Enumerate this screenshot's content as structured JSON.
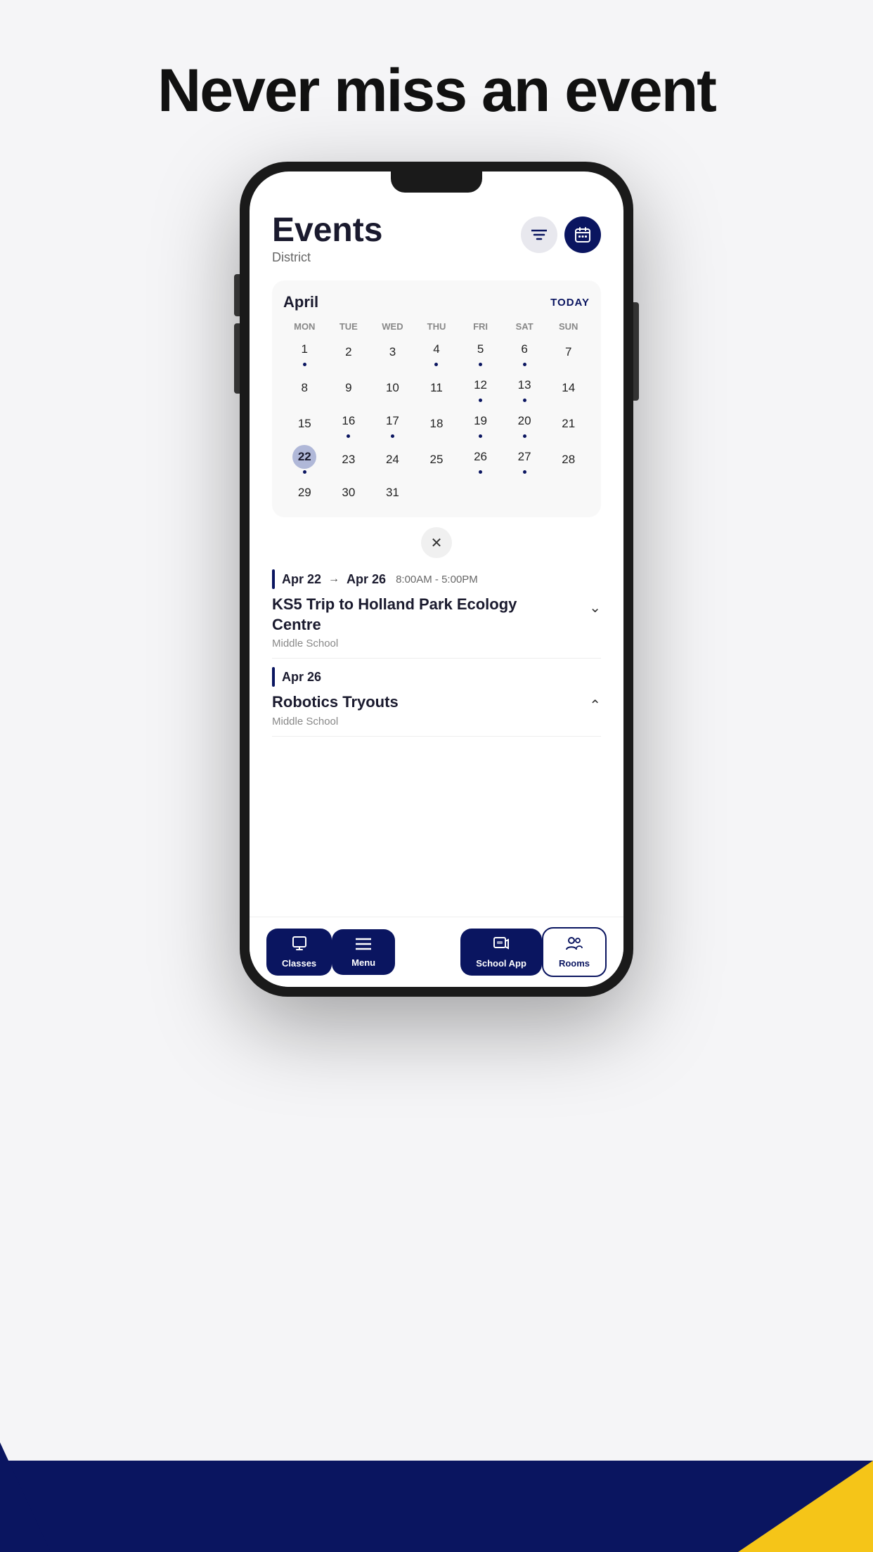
{
  "hero": {
    "title": "Never miss an event"
  },
  "app": {
    "screen_title": "Events",
    "screen_subtitle": "District"
  },
  "calendar": {
    "month": "April",
    "today_label": "TODAY",
    "days_of_week": [
      "MON",
      "TUE",
      "WED",
      "THU",
      "FRI",
      "SAT",
      "SUN"
    ],
    "weeks": [
      [
        {
          "num": "1",
          "dot": true
        },
        {
          "num": "2",
          "dot": false
        },
        {
          "num": "3",
          "dot": false
        },
        {
          "num": "4",
          "dot": true
        },
        {
          "num": "5",
          "dot": true
        },
        {
          "num": "6",
          "dot": true
        },
        {
          "num": "7",
          "dot": false
        }
      ],
      [
        {
          "num": "8",
          "dot": false
        },
        {
          "num": "9",
          "dot": false
        },
        {
          "num": "10",
          "dot": false
        },
        {
          "num": "11",
          "dot": false
        },
        {
          "num": "12",
          "dot": true
        },
        {
          "num": "13",
          "dot": true
        },
        {
          "num": "14",
          "dot": false
        }
      ],
      [
        {
          "num": "15",
          "dot": false
        },
        {
          "num": "16",
          "dot": true
        },
        {
          "num": "17",
          "dot": true
        },
        {
          "num": "18",
          "dot": false
        },
        {
          "num": "19",
          "dot": true
        },
        {
          "num": "20",
          "dot": true
        },
        {
          "num": "21",
          "dot": false
        }
      ],
      [
        {
          "num": "22",
          "dot": true,
          "selected": true
        },
        {
          "num": "23",
          "dot": false
        },
        {
          "num": "24",
          "dot": false
        },
        {
          "num": "25",
          "dot": false
        },
        {
          "num": "26",
          "dot": true
        },
        {
          "num": "27",
          "dot": true
        },
        {
          "num": "28",
          "dot": false
        }
      ],
      [
        {
          "num": "29",
          "dot": false
        },
        {
          "num": "30",
          "dot": false
        },
        {
          "num": "31",
          "dot": false
        },
        null,
        null,
        null,
        null
      ]
    ]
  },
  "events": [
    {
      "date_start": "Apr 22",
      "date_end": "Apr 26",
      "time": "8:00AM - 5:00PM",
      "title": "KS5 Trip to Holland Park Ecology Centre",
      "school": "Middle School",
      "expanded": false
    },
    {
      "date_start": "Apr 26",
      "date_end": null,
      "time": null,
      "title": "Robotics Tryouts",
      "school": "Middle School",
      "expanded": true
    }
  ],
  "nav": {
    "items": [
      {
        "label": "Classes",
        "icon": "🎓",
        "active": false
      },
      {
        "label": "Menu",
        "icon": "☰",
        "active": false
      },
      {
        "label": "School App",
        "icon": "💬",
        "active": false
      },
      {
        "label": "Rooms",
        "icon": "👥",
        "active": true
      }
    ]
  },
  "buttons": {
    "filter_icon": "≡",
    "calendar_icon": "📅",
    "close_icon": "✕",
    "today": "TODAY"
  }
}
